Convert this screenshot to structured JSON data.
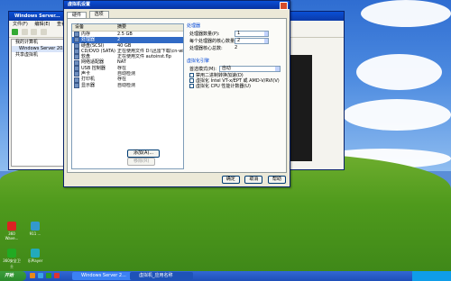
{
  "vmware": {
    "title": "Windows Server...",
    "menu": [
      "文件(F)",
      "编辑(E)",
      "查看(V)"
    ],
    "tree": [
      "我的计算机",
      "Windows Server 20...",
      "共享虚拟机"
    ]
  },
  "dialog": {
    "title": "虚拟机设置",
    "tabs": [
      "硬件",
      "选项"
    ],
    "columns": [
      "设备",
      "摘要"
    ],
    "devices": [
      {
        "name": "内存",
        "summary": "2.5 GB"
      },
      {
        "name": "处理器",
        "summary": "2"
      },
      {
        "name": "硬盘(SCSI)",
        "summary": "40 GB"
      },
      {
        "name": "CD/DVD (SATA)",
        "summary": "正在使用文件 D:\\迅雷下载\\cn-win..."
      },
      {
        "name": "软盘",
        "summary": "正在使用文件 autoinst.flp"
      },
      {
        "name": "网络适配器",
        "summary": "NAT"
      },
      {
        "name": "USB 控制器",
        "summary": "存在"
      },
      {
        "name": "声卡",
        "summary": "自动检测"
      },
      {
        "name": "打印机",
        "summary": "存在"
      },
      {
        "name": "显示器",
        "summary": "自动检测"
      }
    ],
    "add_button": "添加(A)...",
    "remove_button": "移除(R)",
    "processor_group": {
      "title": "处理器",
      "rows": [
        {
          "label": "处理器数量(P):",
          "value": "1"
        },
        {
          "label": "每个处理器的核心数量(C):",
          "value": "2"
        },
        {
          "label": "处理器核心总数:",
          "value": "2"
        }
      ]
    },
    "virt_group": {
      "title": "虚拟化引擎",
      "mode_label": "首选模式(M):",
      "mode_value": "自动",
      "checks": [
        "禁用二进制转换加速(D)",
        "虚拟化 Intel VT-x/EPT 或 AMD-V/RVI(V)",
        "虚拟化 CPU 性能计数器(U)"
      ]
    },
    "ok_button": "确定",
    "cancel_button": "取消",
    "help_button": "帮助"
  },
  "desktop_icons": [
    {
      "label": "360 Wave...",
      "color": "#d22"
    },
    {
      "label": "911 ...",
      "color": "#39c"
    },
    {
      "label": "360安全卫士",
      "color": "#2a2"
    },
    {
      "label": "乐Player",
      "color": "#2ab"
    }
  ],
  "taskbar": {
    "start_label": "开始",
    "tasks": [
      "Windows Server 2...",
      "虚拟机_应用名称"
    ],
    "clock": ""
  }
}
